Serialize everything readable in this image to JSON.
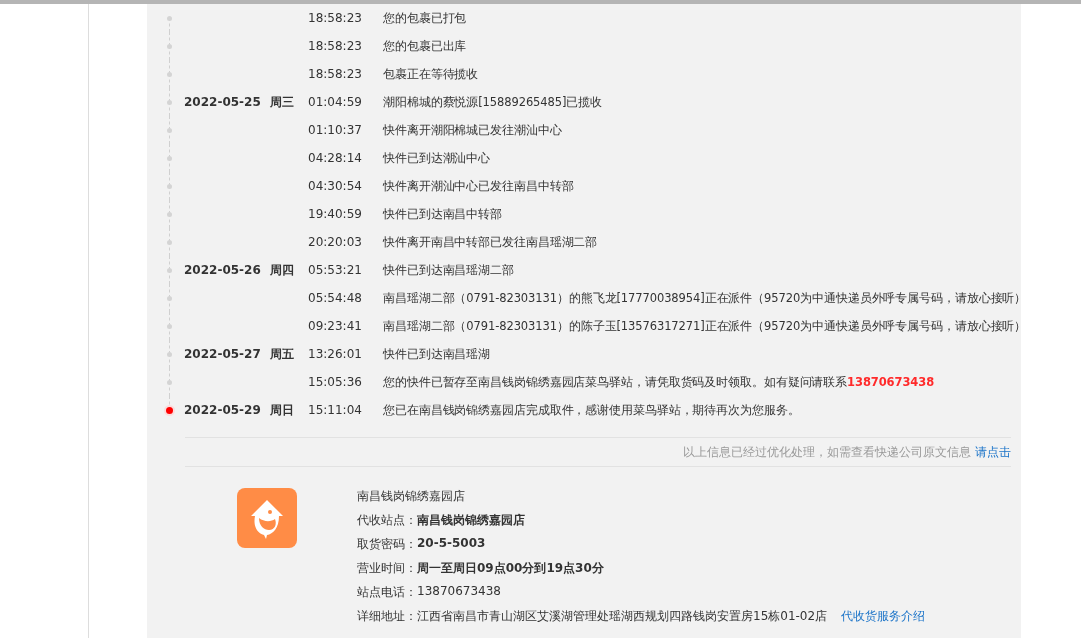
{
  "events": [
    {
      "time": "18:58:23",
      "text": "您的包裹已打包",
      "latest": false
    },
    {
      "time": "18:58:23",
      "text": "您的包裹已出库",
      "latest": false
    },
    {
      "time": "18:58:23",
      "text": "包裹正在等待揽收",
      "latest": false
    },
    {
      "date": "2022-05-25",
      "weekday": "周三",
      "time": "01:04:59",
      "text": "潮阳棉城的蔡悦源[15889265485]已揽收",
      "latest": false
    },
    {
      "time": "01:10:37",
      "text": "快件离开潮阳棉城已发往潮汕中心",
      "latest": false
    },
    {
      "time": "04:28:14",
      "text": "快件已到达潮汕中心",
      "latest": false
    },
    {
      "time": "04:30:54",
      "text": "快件离开潮汕中心已发往南昌中转部",
      "latest": false
    },
    {
      "time": "19:40:59",
      "text": "快件已到达南昌中转部",
      "latest": false
    },
    {
      "time": "20:20:03",
      "text": "快件离开南昌中转部已发往南昌瑶湖二部",
      "latest": false
    },
    {
      "date": "2022-05-26",
      "weekday": "周四",
      "time": "05:53:21",
      "text": "快件已到达南昌瑶湖二部",
      "latest": false
    },
    {
      "time": "05:54:48",
      "text": "南昌瑶湖二部（0791-82303131）的熊飞龙[17770038954]正在派件（95720为中通快递员外呼专属号码，请放心接听）",
      "latest": false
    },
    {
      "time": "09:23:41",
      "text": "南昌瑶湖二部（0791-82303131）的陈子玉[13576317271]正在派件（95720为中通快递员外呼专属号码，请放心接听）",
      "latest": false
    },
    {
      "date": "2022-05-27",
      "weekday": "周五",
      "time": "13:26:01",
      "text": "快件已到达南昌瑶湖",
      "latest": false
    },
    {
      "time": "15:05:36",
      "text": "您的快件已暂存至南昌钱岗锦绣嘉园店菜鸟驿站，请凭取货码及时领取。如有疑问请联系",
      "contact_phone": "13870673438",
      "latest": false
    },
    {
      "date": "2022-05-29",
      "weekday": "周日",
      "time": "15:11:04",
      "text": "您已在南昌钱岗锦绣嘉园店完成取件，感谢使用菜鸟驿站，期待再次为您服务。",
      "latest": true
    }
  ],
  "notice": {
    "text": "以上信息已经过优化处理，如需查看快递公司原文信息",
    "link": "请点击"
  },
  "station": {
    "name": "南昌钱岗锦绣嘉园店",
    "fields": [
      {
        "label": "代收站点：",
        "value": "南昌钱岗锦绣嘉园店",
        "kind": "bold"
      },
      {
        "label": "取货密码：",
        "value": "20-5-5003",
        "kind": "bold"
      },
      {
        "label": "营业时间：",
        "value": "周一至周日09点00分到19点30分",
        "kind": "bold"
      },
      {
        "label": "站点电话：",
        "value": "13870673438",
        "kind": "plain"
      },
      {
        "label": "详细地址：",
        "value": "江西省南昌市青山湖区艾溪湖管理处瑶湖西规划四路钱岗安置房15栋01-02店",
        "kind": "plain"
      }
    ],
    "service_link": "代收货服务介绍"
  }
}
